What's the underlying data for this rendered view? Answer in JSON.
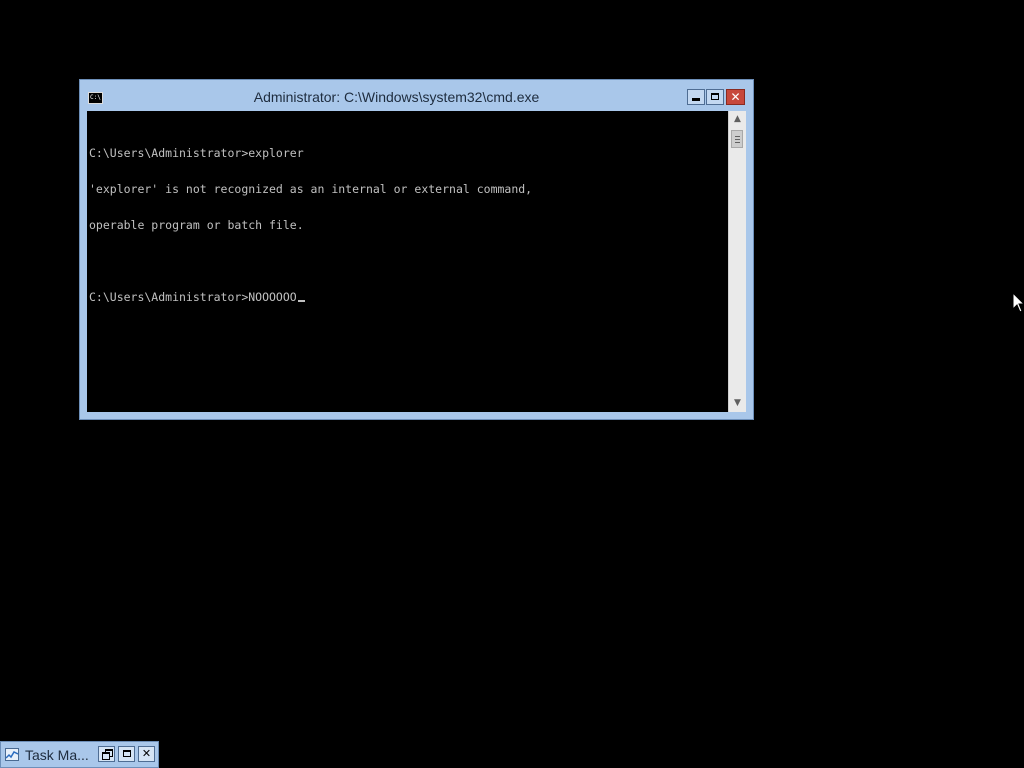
{
  "cmd_window": {
    "title": "Administrator: C:\\Windows\\system32\\cmd.exe",
    "app_icon_text": "C:\\",
    "console_lines": [
      "C:\\Users\\Administrator>explorer",
      "'explorer' is not recognized as an internal or external command,",
      "operable program or batch file.",
      "",
      "C:\\Users\\Administrator>NOOOOOO"
    ],
    "buttons": {
      "minimize": "minimize",
      "maximize": "maximize",
      "close": "✕"
    }
  },
  "minimized_window": {
    "label": "Task Ma...",
    "close": "✕"
  },
  "colors": {
    "desktop": "#000000",
    "window_frame": "#a9c7ea",
    "close_button": "#c7483c",
    "console_text": "#c0c0c0"
  }
}
